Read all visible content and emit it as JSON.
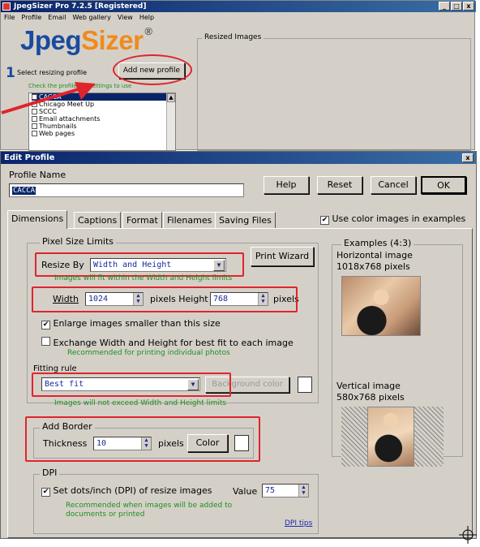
{
  "main_window": {
    "title": "JpegSizer Pro 7.2.5 [Registered]",
    "window_buttons": [
      "_",
      "□",
      "x"
    ],
    "menu": [
      "File",
      "Profile",
      "Email",
      "Web gallery",
      "View",
      "Help"
    ],
    "logo": {
      "part1": "Jpeg",
      "part2": "Sizer",
      "mark": "®"
    },
    "step_number": "1",
    "step_label": "Select resizing profile",
    "add_profile_button": "Add new profile",
    "check_hint": "Check the profile the settings to use",
    "resized_images_label": "Resized Images",
    "profiles": [
      {
        "label": "CACCA",
        "checked": true,
        "selected": true
      },
      {
        "label": "Chicago Meet Up",
        "checked": false,
        "selected": false
      },
      {
        "label": "SCCC",
        "checked": false,
        "selected": false
      },
      {
        "label": "Email attachments",
        "checked": false,
        "selected": false
      },
      {
        "label": "Thumbnails",
        "checked": false,
        "selected": false
      },
      {
        "label": "Web pages",
        "checked": false,
        "selected": false
      }
    ]
  },
  "dialog": {
    "title": "Edit Profile",
    "close": "x",
    "profile_name_label": "Profile Name",
    "profile_name_value": "CACCA",
    "buttons": {
      "help": "Help",
      "reset": "Reset",
      "cancel": "Cancel",
      "ok": "OK"
    },
    "tabs": [
      "Dimensions",
      "Captions",
      "Format",
      "Filenames",
      "Saving Files"
    ],
    "use_color_label": "Use color images in examples",
    "pixel_limits": {
      "legend": "Pixel Size Limits",
      "resize_by_label": "Resize By",
      "resize_by_value": "Width and Height",
      "print_wizard": "Print Wizard",
      "fit_note": "Images will fit within the Width and Height limits",
      "width_label": "Width",
      "width_value": "1024",
      "pixels_height_label": "pixels Height",
      "height_value": "768",
      "pixels_label": "pixels",
      "enlarge_label": "Enlarge images smaller than this size",
      "exchange_label": "Exchange Width and Height for best fit to each image",
      "exchange_note": "Recommended for printing individual photos",
      "fitting_rule_label": "Fitting rule",
      "fitting_rule_value": "Best fit",
      "background_color": "Background color",
      "exceed_note": "Images will not exceed Width and Height limits"
    },
    "border": {
      "legend": "Add Border",
      "thickness_label": "Thickness",
      "thickness_value": "10",
      "pixels_label": "pixels",
      "color_button": "Color"
    },
    "dpi": {
      "legend": "DPI",
      "set_label": "Set dots/inch (DPI) of resize images",
      "value_label": "Value",
      "value": "75",
      "note": "Recommended when images will be added to documents or printed",
      "tips_link": "DPI tips"
    },
    "examples": {
      "legend": "Examples (4:3)",
      "horizontal_title": "Horizontal image",
      "horizontal_size": "1018x768 pixels",
      "vertical_title": "Vertical image",
      "vertical_size": "580x768 pixels"
    }
  },
  "colors": {
    "highlight": "#e0242c",
    "title_blue": "#0a246a",
    "green_note": "#1f8f1f"
  }
}
